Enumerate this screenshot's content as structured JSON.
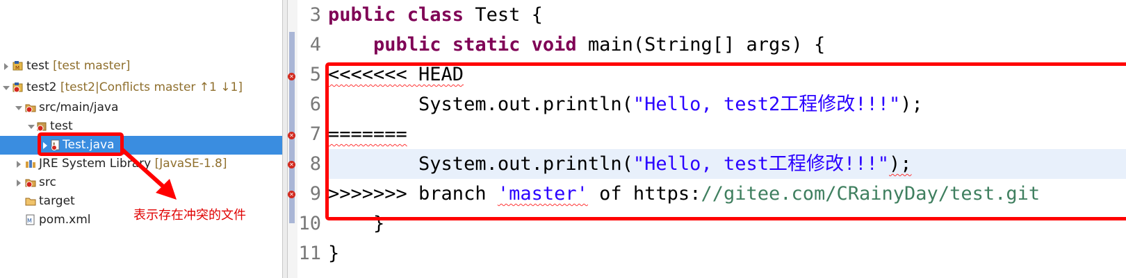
{
  "explorer": {
    "items": [
      {
        "label": "test",
        "decoration": "[test master]"
      },
      {
        "label": "test2",
        "decoration": "[test2|Conflicts master ↑1 ↓1]"
      },
      {
        "label": "src/main/java",
        "decoration": ""
      },
      {
        "label": "test",
        "decoration": ""
      },
      {
        "label": "Test.java",
        "decoration": ""
      },
      {
        "label": "JRE System Library",
        "decoration": "[JavaSE-1.8]"
      },
      {
        "label": "src",
        "decoration": ""
      },
      {
        "label": "target",
        "decoration": ""
      },
      {
        "label": "pom.xml",
        "decoration": ""
      }
    ],
    "annotation": "表示存在冲突的文件"
  },
  "editor": {
    "line_numbers": [
      "3",
      "4",
      "5",
      "6",
      "7",
      "8",
      "9",
      "10",
      "11"
    ],
    "lines": {
      "l3": {
        "kw": "public class",
        "rest": " Test {"
      },
      "l4": {
        "indent": "    ",
        "kw": "public static void",
        "rest": " main(String[] args) {"
      },
      "l5": {
        "text": "<<<<<<< HEAD"
      },
      "l6": {
        "pre": "        System.out.println(",
        "str": "\"Hello, test2工程修改!!!\"",
        "post": ");"
      },
      "l7": {
        "text": "======="
      },
      "l8": {
        "pre": "        System.out.println(",
        "str": "\"Hello, test工程修改!!!\"",
        "post": ");"
      },
      "l9": {
        "pre": ">>>>>>> branch ",
        "str": "'master'",
        "mid": " of https:",
        "url": "//gitee.com/CRainyDay/test.git"
      },
      "l10": {
        "text": "    }"
      },
      "l11": {
        "text": "}"
      }
    }
  },
  "colors": {
    "keyword": "#7f0055",
    "string": "#2a00ff",
    "highlight_box": "#ff0000",
    "selection": "#3a8de0"
  }
}
